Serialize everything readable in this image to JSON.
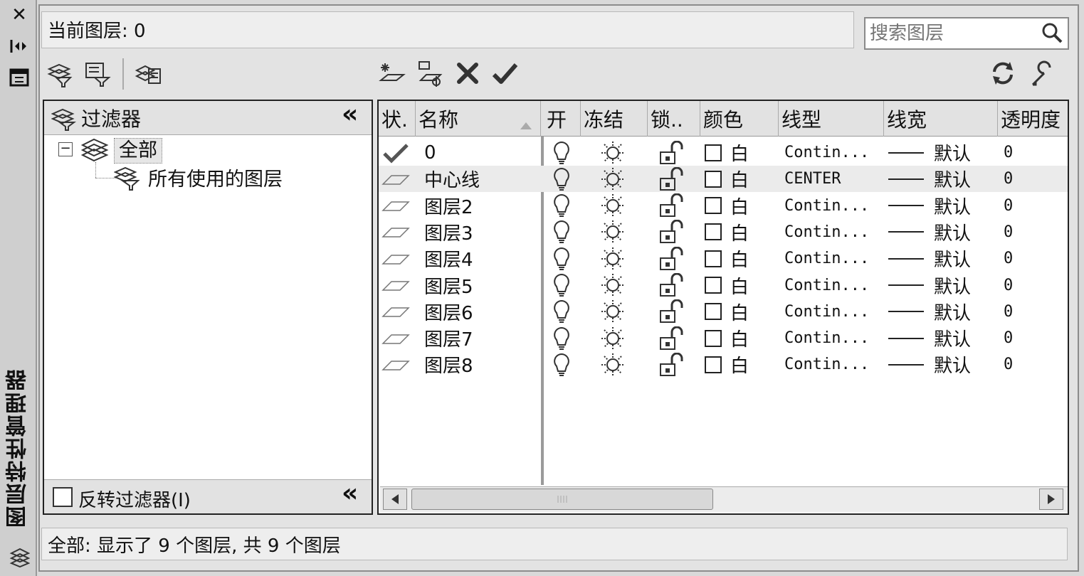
{
  "palette": {
    "title": "图层特性管理器"
  },
  "current_layer_label": "当前图层: 0",
  "search": {
    "placeholder": "搜索图层"
  },
  "filter_panel": {
    "header": "过滤器",
    "tree_root": "全部",
    "tree_child": "所有使用的图层",
    "invert_label": "反转过滤器(I)",
    "collapse_glyph": "«"
  },
  "columns": {
    "status": "状.",
    "name": "名称",
    "on": "开",
    "freeze": "冻结",
    "lock": "锁..",
    "color": "颜色",
    "linetype": "线型",
    "lineweight": "线宽",
    "transparency": "透明度"
  },
  "layers": [
    {
      "name": "0",
      "color": "白",
      "linetype": "Contin...",
      "lineweight": "默认",
      "transparency": "0",
      "current": true
    },
    {
      "name": "中心线",
      "color": "白",
      "linetype": "CENTER",
      "lineweight": "默认",
      "transparency": "0",
      "current": false
    },
    {
      "name": "图层2",
      "color": "白",
      "linetype": "Contin...",
      "lineweight": "默认",
      "transparency": "0",
      "current": false
    },
    {
      "name": "图层3",
      "color": "白",
      "linetype": "Contin...",
      "lineweight": "默认",
      "transparency": "0",
      "current": false
    },
    {
      "name": "图层4",
      "color": "白",
      "linetype": "Contin...",
      "lineweight": "默认",
      "transparency": "0",
      "current": false
    },
    {
      "name": "图层5",
      "color": "白",
      "linetype": "Contin...",
      "lineweight": "默认",
      "transparency": "0",
      "current": false
    },
    {
      "name": "图层6",
      "color": "白",
      "linetype": "Contin...",
      "lineweight": "默认",
      "transparency": "0",
      "current": false
    },
    {
      "name": "图层7",
      "color": "白",
      "linetype": "Contin...",
      "lineweight": "默认",
      "transparency": "0",
      "current": false
    },
    {
      "name": "图层8",
      "color": "白",
      "linetype": "Contin...",
      "lineweight": "默认",
      "transparency": "0",
      "current": false
    }
  ],
  "status_text": "全部: 显示了 9 个图层, 共 9 个图层"
}
